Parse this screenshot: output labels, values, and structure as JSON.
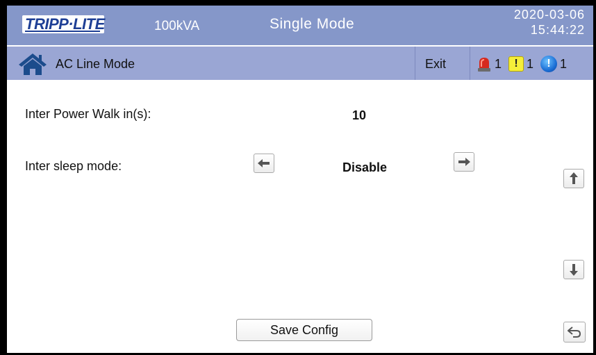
{
  "header": {
    "brand": "TRIPP·LITE",
    "capacity": "100kVA",
    "mode": "Single Mode",
    "date": "2020-03-06",
    "time": "15:44:22"
  },
  "subheader": {
    "status": "AC Line Mode",
    "exit_label": "Exit",
    "alarms": {
      "critical_count": "1",
      "warning_count": "1",
      "info_count": "1"
    }
  },
  "settings": {
    "walk_in_label": "Inter Power Walk in(s):",
    "walk_in_value": "10",
    "sleep_label": "Inter sleep mode:",
    "sleep_value": "Disable"
  },
  "actions": {
    "save_label": "Save Config"
  },
  "colors": {
    "header_bg": "#8597c9",
    "subheader_bg": "#9aa6d4",
    "brand": "#1e3f95"
  },
  "icons": {
    "home": "home-icon",
    "critical": "siren-icon",
    "warning": "warning-icon",
    "info": "info-icon",
    "prev": "arrow-left-icon",
    "next": "arrow-right-icon",
    "scroll_up": "arrow-up-icon",
    "scroll_down": "arrow-down-icon",
    "back": "back-icon"
  }
}
